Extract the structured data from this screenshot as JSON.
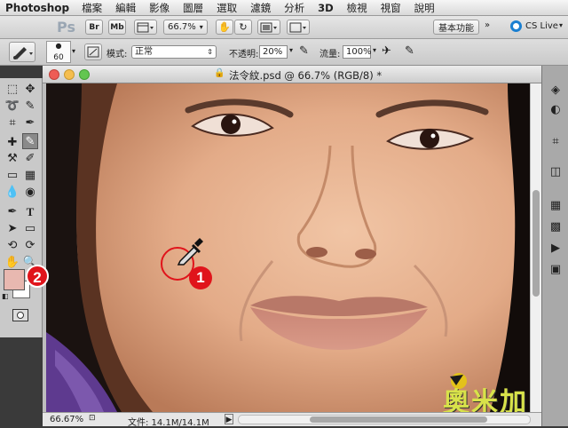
{
  "menubar": {
    "app_name": "Photoshop",
    "items": [
      "檔案",
      "編輯",
      "影像",
      "圖層",
      "選取",
      "濾鏡",
      "分析",
      "3D",
      "檢視",
      "視窗",
      "說明"
    ]
  },
  "appbar": {
    "ps_logo": "Ps",
    "br_button": "Br",
    "mb_button": "Mb",
    "zoom_value": "66.7%",
    "workspace_label": "基本功能",
    "cslive_label": "CS Live"
  },
  "options": {
    "brush_size": "60",
    "mode_label": "模式:",
    "mode_value": "正常",
    "opacity_label": "不透明:",
    "opacity_value": "20%",
    "flow_label": "流量:",
    "flow_value": "100%"
  },
  "document": {
    "title": "法令紋.psd @ 66.7% (RGB/8) *",
    "status_zoom": "66.67%",
    "status_info": "文件: 14.1M/14.1M"
  },
  "annotations": {
    "marker_1": "1",
    "marker_2": "2"
  },
  "watermark": {
    "text": "奧米加"
  },
  "colors": {
    "foreground_swatch": "#e8b8b0",
    "background_swatch": "#ffffff",
    "badge_red": "#e0141b",
    "skin_tone": "#e8b797"
  }
}
